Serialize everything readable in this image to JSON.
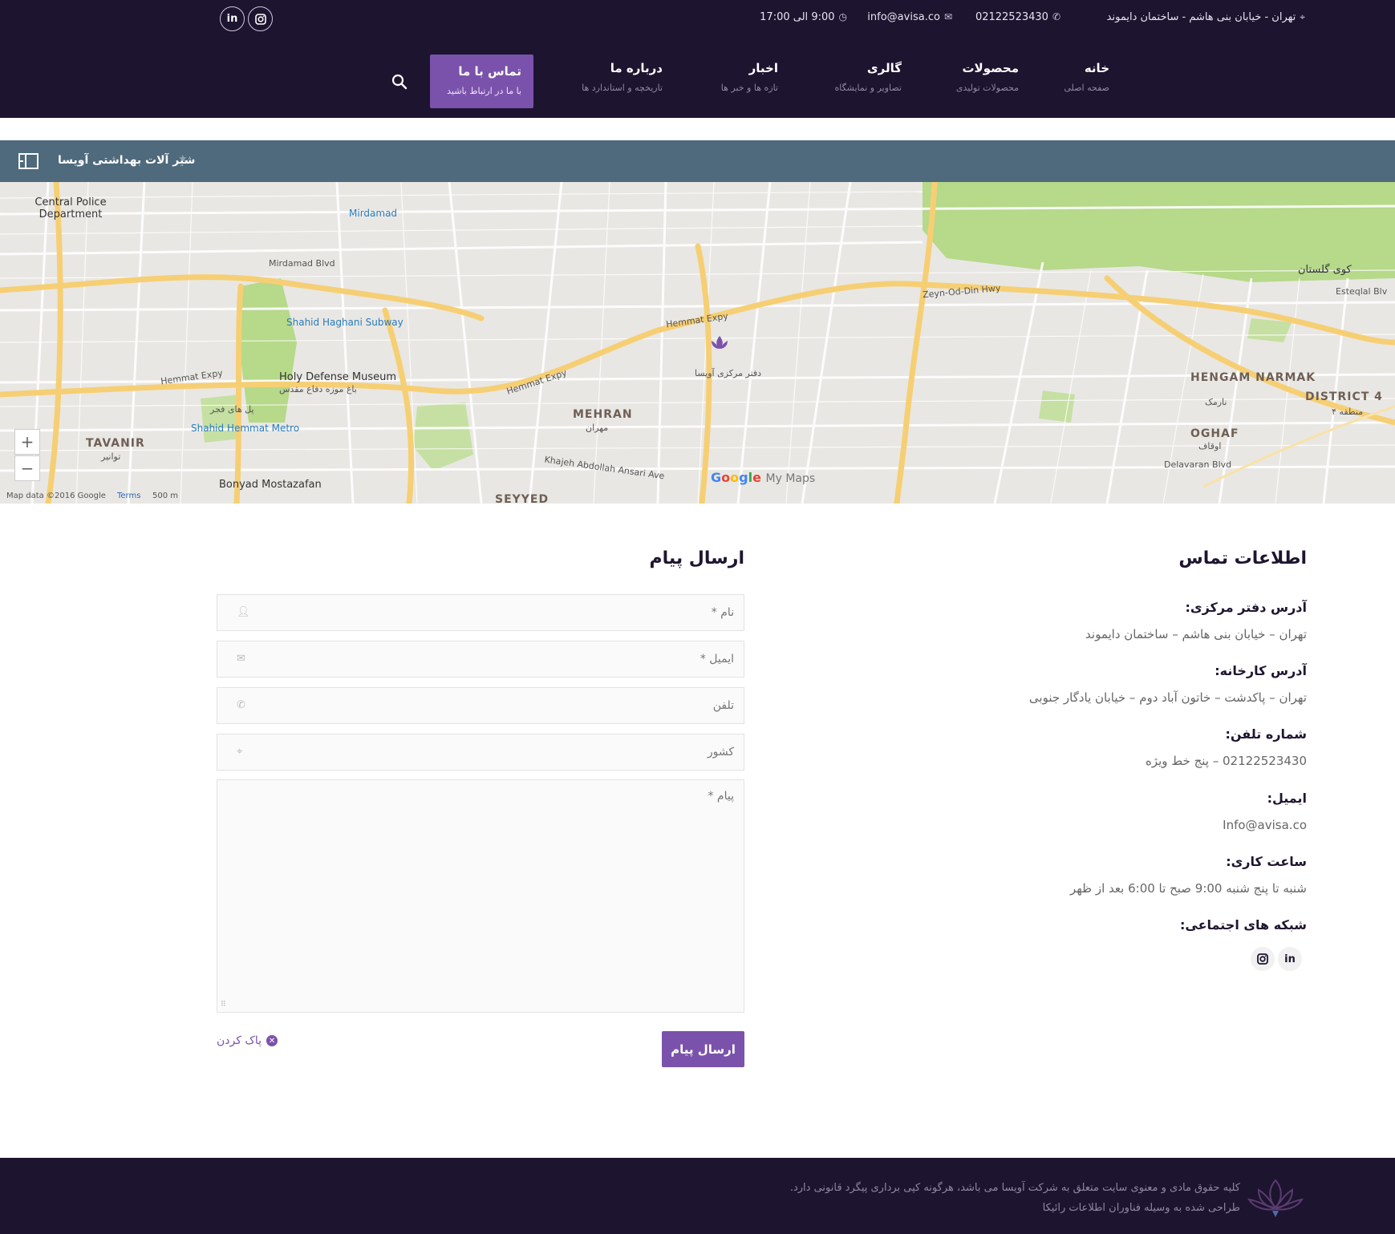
{
  "topbar": {
    "address": "تهران - خیابان بنی هاشم - ساختمان دایموند",
    "phone": "02122523430",
    "email": "info@avisa.co",
    "hours": "9:00 الی 17:00",
    "social": [
      "in",
      "ig"
    ]
  },
  "nav": {
    "items": [
      {
        "title": "خانه",
        "sub": "صفحه اصلی"
      },
      {
        "title": "محصولات",
        "sub": "محصولات تولیدی"
      },
      {
        "title": "گالری",
        "sub": "تصاویر و نمایشگاه"
      },
      {
        "title": "اخبار",
        "sub": "تازه ها و خبر ها"
      },
      {
        "title": "درباره ما",
        "sub": "تاریخچه و استاندارد ها"
      }
    ],
    "active": {
      "title": "تماس با ما",
      "sub": "با ما در ارتباط باشید"
    }
  },
  "breadcrumb": {
    "text": "شیر آلات بهداشتی آویسا",
    "star": "★"
  },
  "map": {
    "zoom_in": "+",
    "zoom_out": "−",
    "footer": "Map data ©2016 Google",
    "terms": "Terms",
    "scale": "500 m",
    "google": [
      "G",
      "o",
      "o",
      "g",
      "l",
      "e"
    ],
    "mymaps": "My Maps",
    "labels": {
      "police": "Central Police Department",
      "mirdamad": "Mirdamad",
      "shahid_haghani": "Shahid Haghani Subway",
      "holy_defense": "Holy Defense Museum",
      "holy_defense_fa": "باغ موزه دفاع مقدس",
      "hemmat_metro": "Shahid Hemmat Metro",
      "tavanir": "TAVANIR",
      "tavanir_fa": "توانیر",
      "mehran": "MEHRAN",
      "mehran_fa": "مهران",
      "hengam": "HENGAM NARMAK",
      "hengam_fa": "نارمک",
      "oghaf": "OGHAF",
      "oghaf_fa": "اوقاف",
      "district": "DISTRICT 4",
      "district_fa": "منطقه ۴",
      "bonyad": "Bonyad Mostazafan",
      "seyyed": "SEYYED",
      "office": "دفتر مرکزی آویسا",
      "hemmat_expy": "Hemmat Expy",
      "zeyn": "Zeyn-Od-Din Hwy",
      "mirdamad_blvd": "Mirdamad Blvd",
      "delavaran": "Delavaran Blvd",
      "golestan": "کوی گلستان",
      "pol_fajr": "پل های فجر",
      "khajeh": "Khajeh Abdollah Ansari Ave",
      "esteqlal": "Esteqlal Blv"
    }
  },
  "contact_info": {
    "title": "اطلاعات تماس",
    "office_label": "آدرس دفتر مرکزی:",
    "office_value": "تهران – خیابان بنی هاشم – ساختمان دایموند",
    "factory_label": "آدرس کارخانه:",
    "factory_value": "تهران – پاکدشت – خاتون آباد دوم – خیابان یادگار جنوبی",
    "phone_label": "شماره تلفن:",
    "phone_value": "02122523430 – پنج خط ویژه",
    "email_label": "ایمیل:",
    "email_value": "Info@avisa.co",
    "hours_label": "ساعت کاری:",
    "hours_value": "شنبه تا پنج شنبه 9:00 صبح تا 6:00 بعد از ظهر",
    "social_label": "شبکه های اجتماعی:",
    "social": [
      "in",
      "ig"
    ]
  },
  "form": {
    "title": "ارسال پیام",
    "name_placeholder": "نام *",
    "email_placeholder": "ایمیل *",
    "phone_placeholder": "تلفن",
    "country_placeholder": "کشور",
    "message_placeholder": "پیام *",
    "submit": "ارسال پیام",
    "clear": "پاک کردن"
  },
  "footer": {
    "copyright": "کلیه حقوق مادی و معنوی سایت متعلق به شرکت آویسا می باشد، هرگونه کپی برداری پیگرد قانونی دارد.",
    "design": "طراحی شده به وسیله فناوران اطلاعات رائیکا"
  },
  "colors": {
    "header_bg": "#1d1430",
    "accent": "#7b52ab",
    "breadcrumb_bg": "#4e6a7c"
  }
}
